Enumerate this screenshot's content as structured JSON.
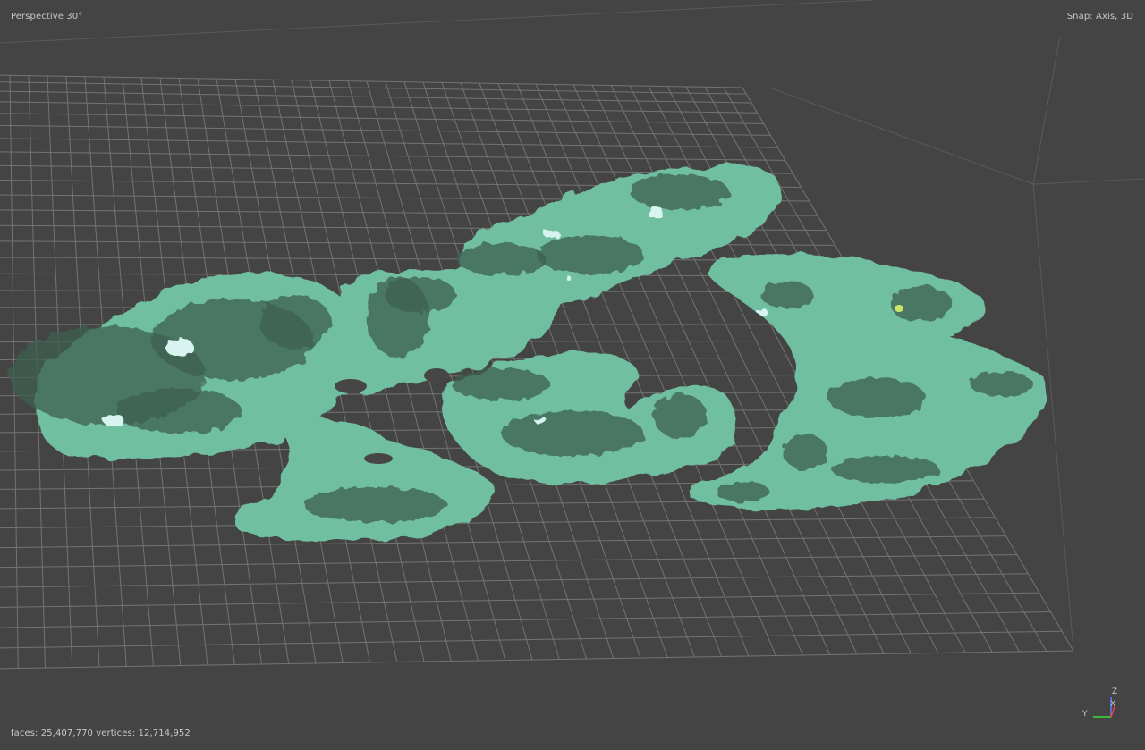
{
  "viewport": {
    "view_mode": "Perspective 30°",
    "snap_mode": "Snap: Axis, 3D"
  },
  "stats": {
    "text": "faces: 25,407,770 vertices: 12,714,952",
    "faces": 25407770,
    "vertices": 12714952
  },
  "axis_gizmo": {
    "z_label": "Z",
    "x_label": "X",
    "y_label": "Y"
  },
  "colors": {
    "background": "#444444",
    "grid_line": "#7c7c7c",
    "mesh_base": "#6fbfa0",
    "overlay_text": "#c8c8c8",
    "axis_x": "#ff3b3b",
    "axis_y": "#3bdc3b",
    "axis_z": "#5a7dff"
  }
}
